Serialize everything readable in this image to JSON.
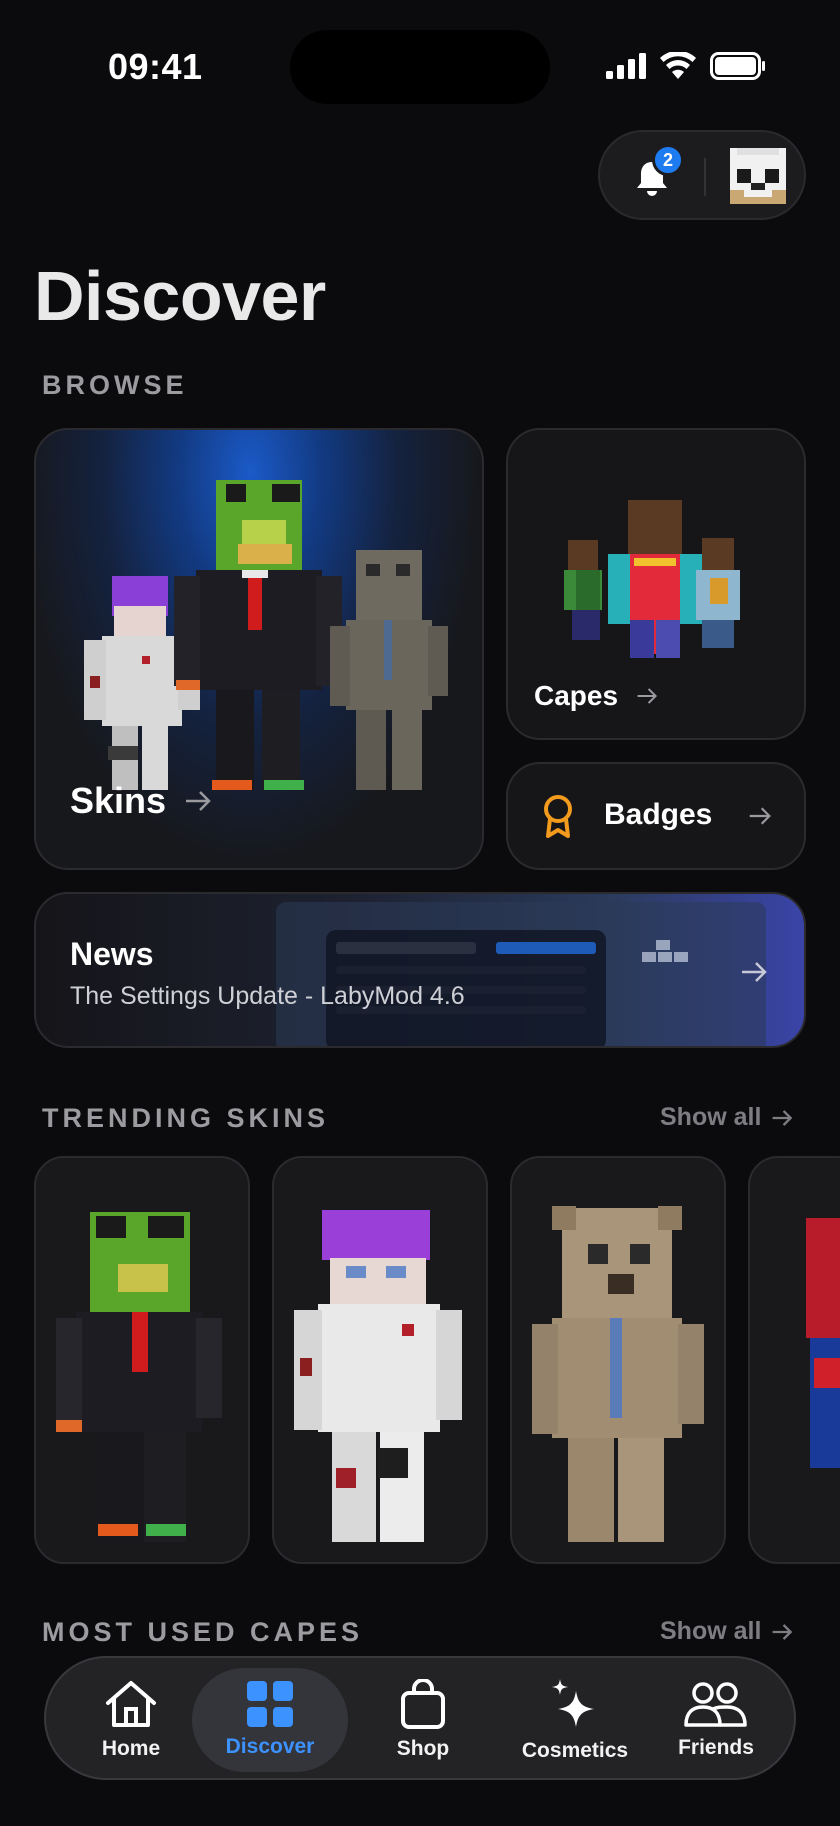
{
  "status_bar": {
    "time": "09:41"
  },
  "header": {
    "notification_count": "2"
  },
  "page": {
    "title": "Discover"
  },
  "browse": {
    "label": "BROWSE",
    "skins": "Skins",
    "capes": "Capes",
    "badges": "Badges",
    "news": {
      "title": "News",
      "subtitle": "The Settings Update - LabyMod 4.6"
    }
  },
  "trending": {
    "label": "TRENDING SKINS",
    "show_all": "Show all"
  },
  "capes_section": {
    "label": "MOST USED CAPES",
    "show_all": "Show all"
  },
  "tabbar": {
    "items": [
      {
        "label": "Home",
        "icon": "home-icon"
      },
      {
        "label": "Discover",
        "icon": "grid-icon",
        "active": true
      },
      {
        "label": "Shop",
        "icon": "shopping-bag-icon"
      },
      {
        "label": "Cosmetics",
        "icon": "sparkles-icon"
      },
      {
        "label": "Friends",
        "icon": "friends-icon"
      }
    ]
  },
  "colors": {
    "accent": "#3c92ff",
    "badge_blue": "#1e7bf0",
    "badge_orange": "#f29b1d"
  }
}
